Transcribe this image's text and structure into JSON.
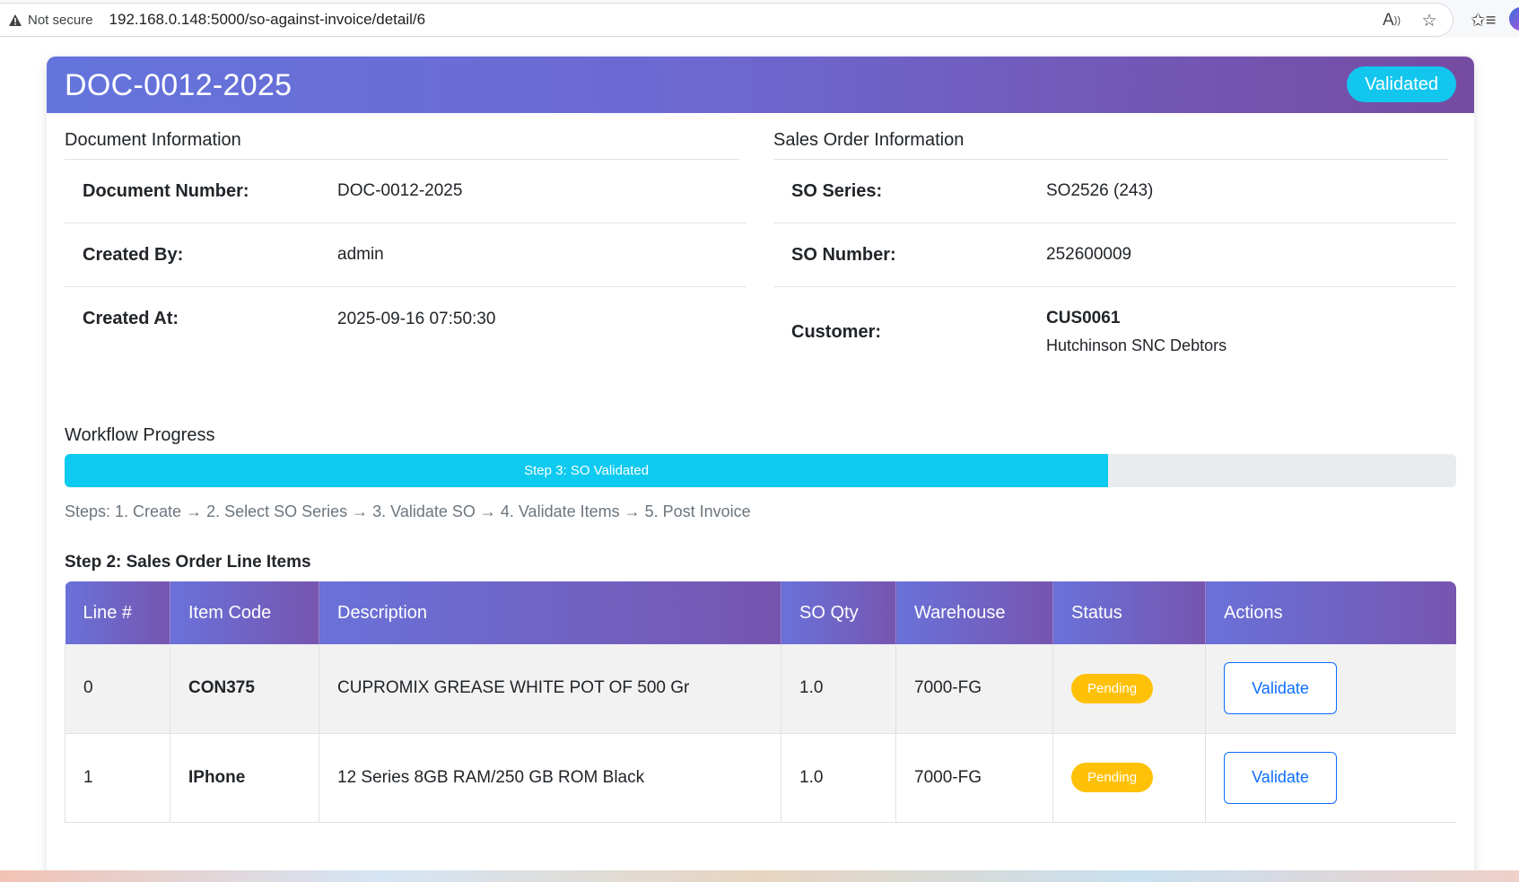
{
  "browser": {
    "security_label": "Not secure",
    "url": "192.168.0.148:5000/so-against-invoice/detail/6",
    "icons": [
      "warning-icon",
      "read-aloud-icon",
      "favorite-star-icon",
      "favorites-icon",
      "profile-avatar"
    ]
  },
  "header": {
    "doc_title": "DOC-0012-2025",
    "status": "Validated",
    "gradient_colors": [
      "#6474dc",
      "#764ba2"
    ]
  },
  "document_info": {
    "title": "Document Information",
    "rows": [
      {
        "label": "Document Number:",
        "value": "DOC-0012-2025"
      },
      {
        "label": "Created By:",
        "value": "admin"
      },
      {
        "label": "Created At:",
        "value": "2025-09-16 07:50:30"
      }
    ]
  },
  "sales_order_info": {
    "title": "Sales Order Information",
    "series_label": "SO Series:",
    "series_value": "SO2526 (243)",
    "number_label": "SO Number:",
    "number_value": "252600009",
    "customer_label": "Customer:",
    "customer_code": "CUS0061",
    "customer_name": "Hutchinson SNC Debtors"
  },
  "workflow": {
    "title": "Workflow Progress",
    "progress_label": "Step 3: SO Validated",
    "progress_percent": 75,
    "steps_text": "Steps: 1. Create → 2. Select SO Series → 3. Validate SO → 4. Validate Items → 5. Post Invoice"
  },
  "line_items": {
    "title": "Step 2: Sales Order Line Items",
    "columns": [
      "Line #",
      "Item Code",
      "Description",
      "SO Qty",
      "Warehouse",
      "Status",
      "Actions"
    ],
    "rows": [
      {
        "line": "0",
        "code": "CON375",
        "description": "CUPROMIX GREASE WHITE POT OF 500 Gr",
        "qty": "1.0",
        "warehouse": "7000-FG",
        "status": "Pending",
        "action": "Validate"
      },
      {
        "line": "1",
        "code": "IPhone",
        "description": "12 Series 8GB RAM/250 GB ROM Black",
        "qty": "1.0",
        "warehouse": "7000-FG",
        "status": "Pending",
        "action": "Validate"
      }
    ]
  },
  "colors": {
    "status_validated": "#12c6ee",
    "status_pending": "#ffc107",
    "progress_fill": "#0dcaf0",
    "button_primary": "#0d6efd"
  }
}
